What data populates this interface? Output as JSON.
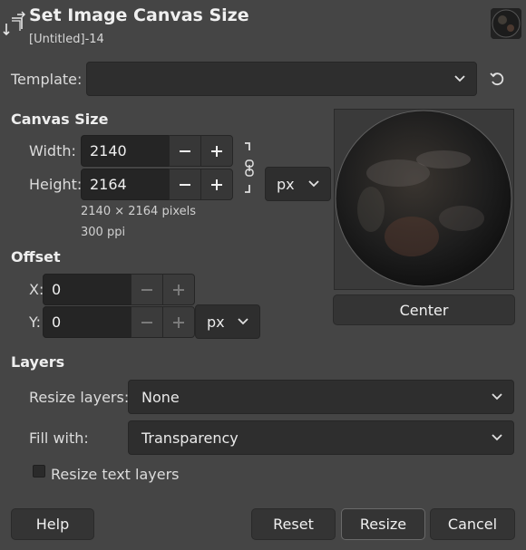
{
  "header": {
    "title": "Set Image Canvas Size",
    "subtitle": "[Untitled]-14"
  },
  "template": {
    "label": "Template:",
    "value": ""
  },
  "canvas_size": {
    "heading": "Canvas Size",
    "width_label": "Width:",
    "width_value": "2140",
    "height_label": "Height:",
    "height_value": "2164",
    "unit": "px",
    "pixels_info": "2140 × 2164 pixels",
    "resolution_info": "300 ppi"
  },
  "offset": {
    "heading": "Offset",
    "x_label": "X:",
    "x_value": "0",
    "y_label": "Y:",
    "y_value": "0",
    "unit": "px",
    "center_label": "Center"
  },
  "layers": {
    "heading": "Layers",
    "resize_layers_label": "Resize layers:",
    "resize_layers_value": "None",
    "fill_with_label": "Fill with:",
    "fill_with_value": "Transparency",
    "resize_text_layers_label": "Resize text layers",
    "resize_text_layers_checked": false
  },
  "buttons": {
    "help": "Help",
    "reset": "Reset",
    "resize": "Resize",
    "cancel": "Cancel"
  },
  "colors": {
    "background": "#454545",
    "field": "#2e2e2e",
    "entry": "#252525",
    "button": "#343434"
  }
}
